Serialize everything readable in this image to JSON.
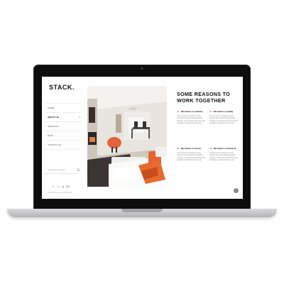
{
  "site": {
    "logo": "STACK."
  },
  "nav": {
    "items": [
      {
        "label": "HOME"
      },
      {
        "label": "ABOUT US",
        "active": true
      },
      {
        "label": "SERVICES"
      },
      {
        "label": "BLOG"
      },
      {
        "label": "CONTACT US"
      }
    ]
  },
  "search": {
    "placeholder": "Search for something"
  },
  "social": {
    "icons": [
      "facebook-icon",
      "twitter-icon",
      "pinterest-icon",
      "google-plus-icon"
    ],
    "glyphs": [
      "f",
      "t",
      "p",
      "G+"
    ]
  },
  "footer": {
    "copyright": "© 2016 Stack. All rights reserved."
  },
  "content": {
    "headline_line1": "SOME REASONS TO",
    "headline_line2": "WORK TOGETHER",
    "reasons": [
      {
        "num": "01.",
        "title": "We believe in creativity",
        "text": "Lorem Ipsum is simply text the printing and typesetting standard industry. Lorem Ipsum has been the industrie's standard dummy text"
      },
      {
        "num": "02.",
        "title": "We believe in quality",
        "text": "Lorem Ipsum is simply text the printing and typesetting standard industry. Lorem Ipsum has been the industrie's standard dummy text"
      },
      {
        "num": "03.",
        "title": "We believe in service",
        "text": "Lorem Ipsum is simply text the printing and typesetting standard industry. Lorem Ipsum has been the industrie's standard dummy text"
      },
      {
        "num": "04.",
        "title": "We believe in teamwork",
        "text": "Lorem Ipsum is simply text the printing and typesetting standard industry. Lorem Ipsum has been the industrie's standard dummy text"
      }
    ]
  },
  "colors": {
    "accent": "#e0655f",
    "frame": "#0d0d0d",
    "chassis": "#c8c8cb"
  }
}
